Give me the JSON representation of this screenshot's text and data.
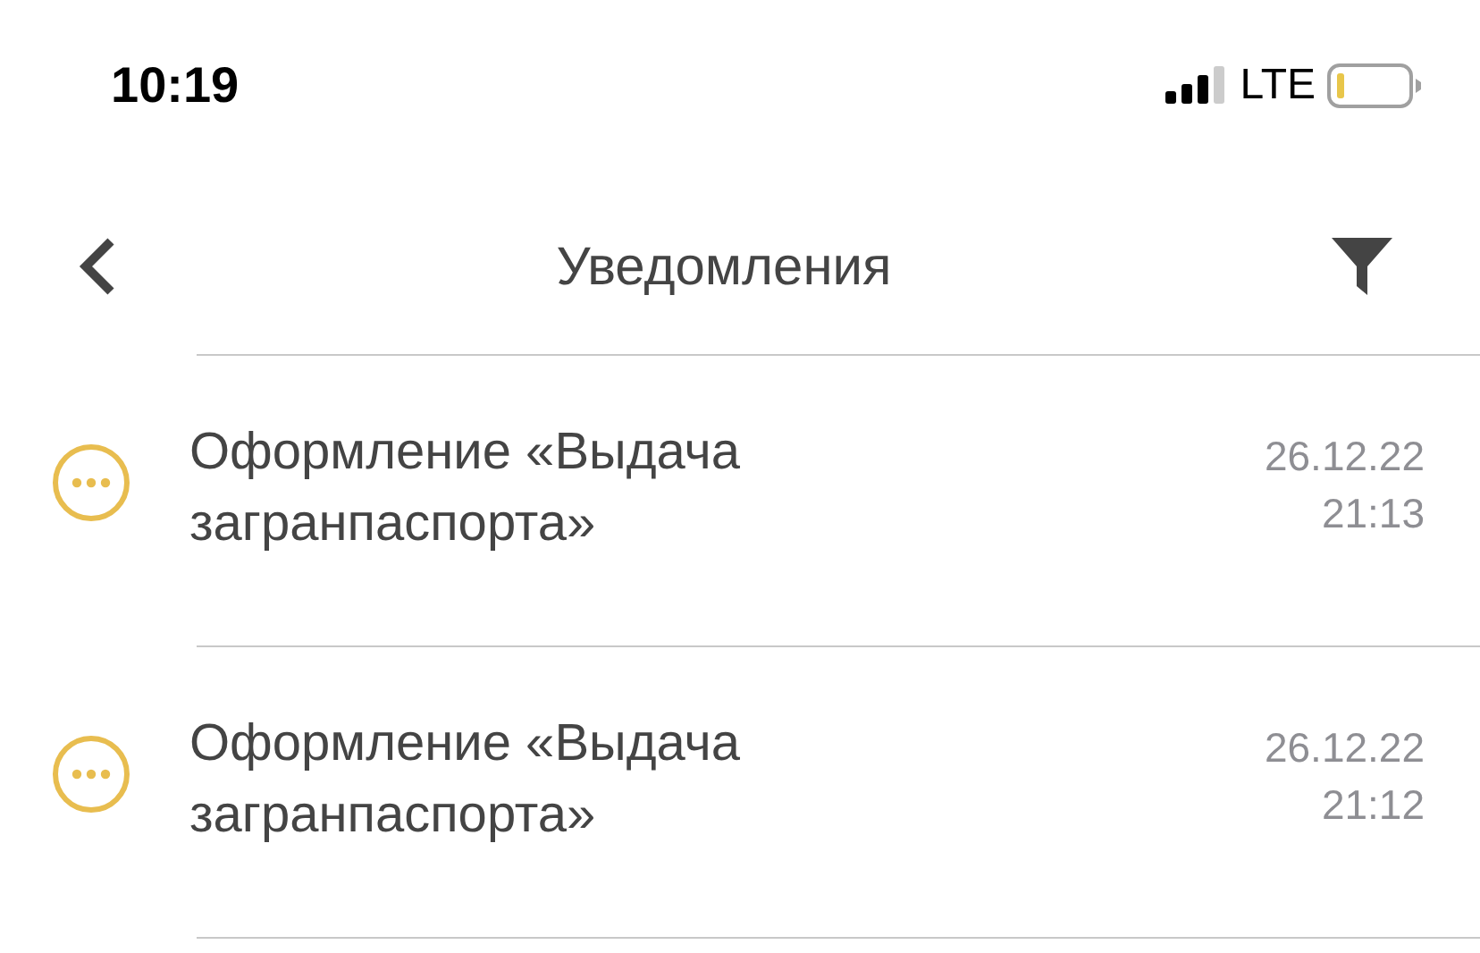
{
  "status_bar": {
    "time": "10:19",
    "network": "LTE"
  },
  "nav": {
    "title": "Уведомления"
  },
  "notifications": [
    {
      "kind": "pending",
      "title": "Оформление «Выдача загранпаспорта»",
      "date": "26.12.22",
      "time": "21:13"
    },
    {
      "kind": "pending",
      "title": "Оформление «Выдача загранпаспорта»",
      "date": "26.12.22",
      "time": "21:12"
    }
  ]
}
